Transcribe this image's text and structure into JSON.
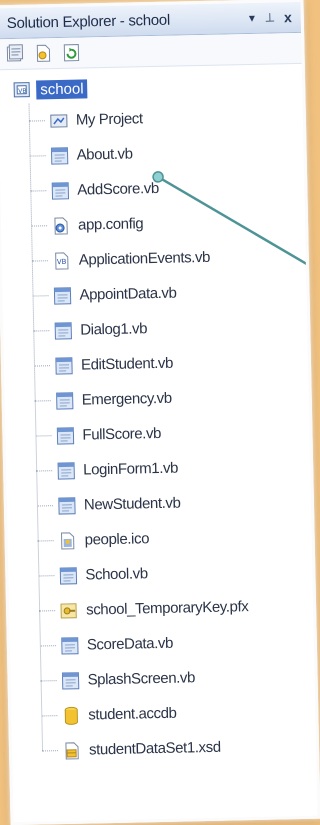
{
  "window": {
    "title": "Solution Explorer - school",
    "controls": [
      "▾",
      "⊥",
      "x"
    ]
  },
  "toolbar": {
    "buttons": [
      "properties-icon",
      "show-all-files-icon",
      "refresh-icon"
    ]
  },
  "tree": {
    "root": "school",
    "items": [
      {
        "label": "My Project",
        "icon": "my-project-icon"
      },
      {
        "label": "About.vb",
        "icon": "form-icon"
      },
      {
        "label": "AddScore.vb",
        "icon": "form-icon"
      },
      {
        "label": "app.config",
        "icon": "config-icon"
      },
      {
        "label": "ApplicationEvents.vb",
        "icon": "vb-code-icon"
      },
      {
        "label": "AppointData.vb",
        "icon": "form-icon"
      },
      {
        "label": "Dialog1.vb",
        "icon": "form-icon"
      },
      {
        "label": "EditStudent.vb",
        "icon": "form-icon"
      },
      {
        "label": "Emergency.vb",
        "icon": "form-icon"
      },
      {
        "label": "FullScore.vb",
        "icon": "form-icon"
      },
      {
        "label": "LoginForm1.vb",
        "icon": "form-icon"
      },
      {
        "label": "NewStudent.vb",
        "icon": "form-icon"
      },
      {
        "label": "people.ico",
        "icon": "ico-file-icon"
      },
      {
        "label": "School.vb",
        "icon": "form-icon"
      },
      {
        "label": "school_TemporaryKey.pfx",
        "icon": "key-file-icon"
      },
      {
        "label": "ScoreData.vb",
        "icon": "form-icon"
      },
      {
        "label": "SplashScreen.vb",
        "icon": "form-icon"
      },
      {
        "label": "student.accdb",
        "icon": "database-icon"
      },
      {
        "label": "studentDataSet1.xsd",
        "icon": "dataset-icon"
      }
    ]
  },
  "colors": {
    "background": "#f1c27f",
    "selection": "#3a69c6",
    "callout": "#5a9ea0"
  }
}
